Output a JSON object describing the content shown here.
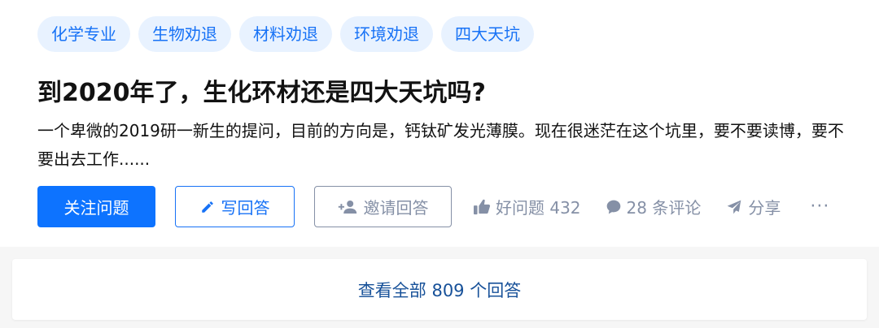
{
  "tags": [
    "化学专业",
    "生物劝退",
    "材料劝退",
    "环境劝退",
    "四大天坑"
  ],
  "question": {
    "title": "到2020年了，生化环材还是四大天坑吗?",
    "excerpt": "一个卑微的2019研一新生的提问，目前的方向是，钙钛矿发光薄膜。现在很迷茫在这个坑里，要不要读博，要不要出去工作......"
  },
  "actions": {
    "follow_label": "关注问题",
    "write_answer_label": "写回答",
    "invite_label": "邀请回答",
    "good_question_label": "好问题 432",
    "comments_label": "28 条评论",
    "share_label": "分享",
    "more_label": "···"
  },
  "view_all": {
    "label": "查看全部 809 个回答"
  },
  "colors": {
    "primary": "#0d73ff",
    "tag_bg": "#e8f2ff",
    "tag_text": "#1772f6",
    "meta_gray": "#8590a6",
    "link_blue": "#175199"
  },
  "icons": [
    "pencil-icon",
    "add-user-icon",
    "thumbs-up-icon",
    "comment-icon",
    "share-icon",
    "more-icon"
  ]
}
